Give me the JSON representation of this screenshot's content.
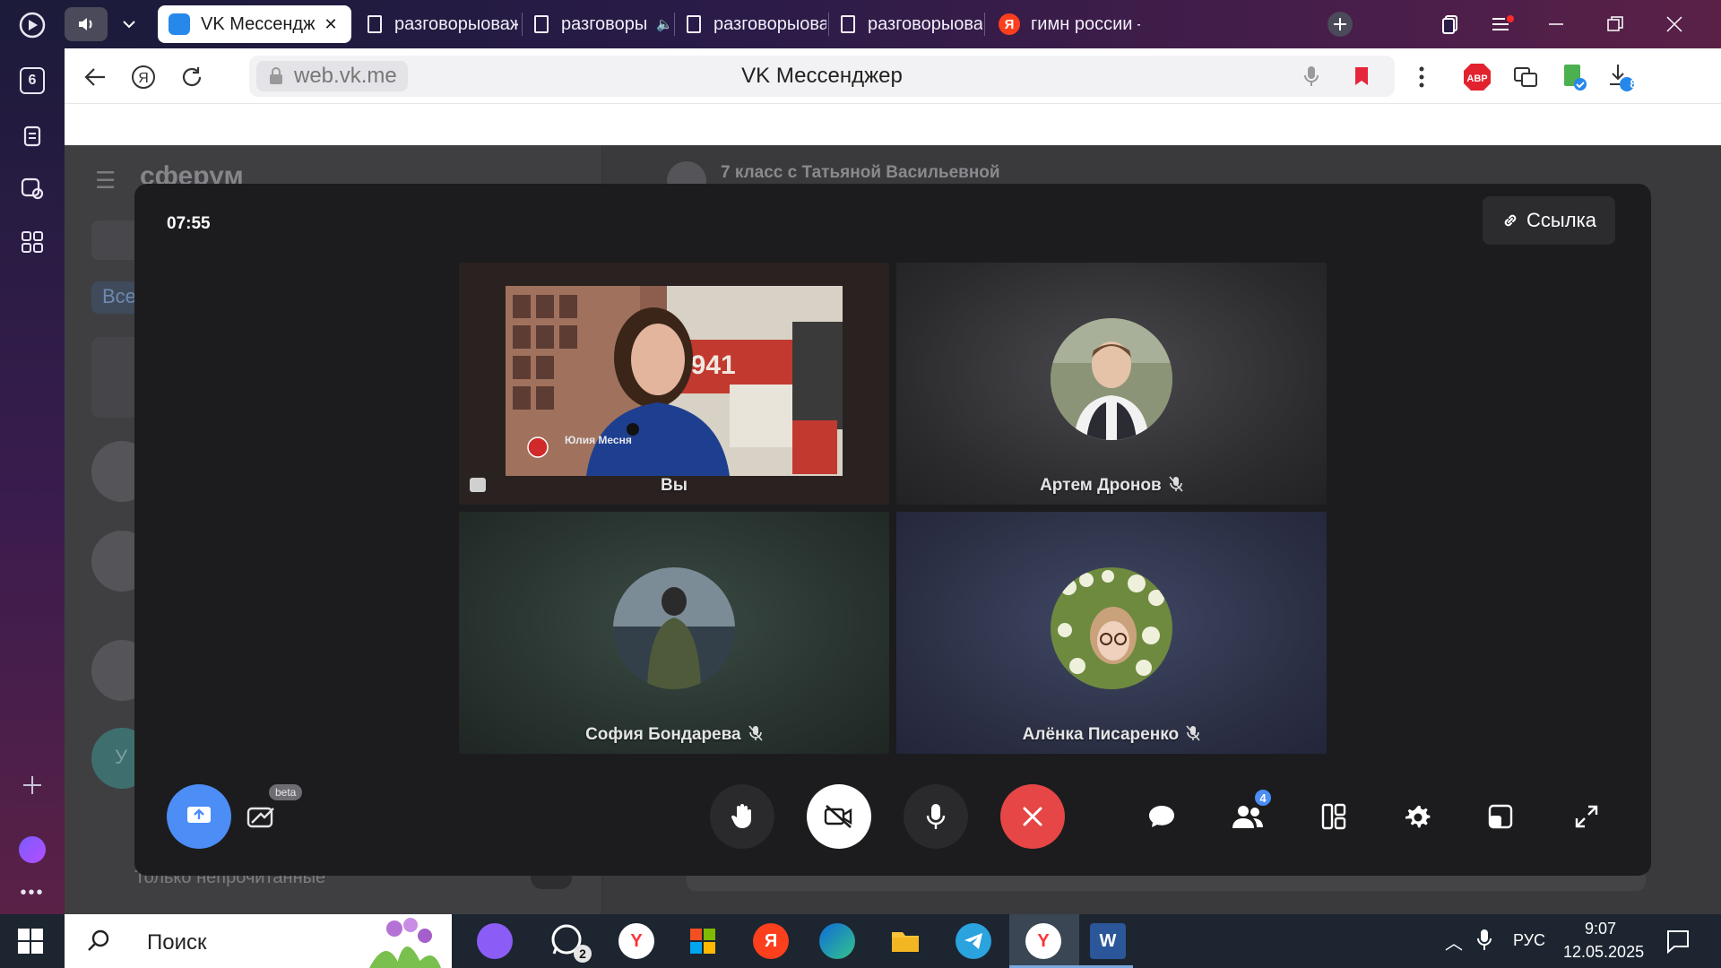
{
  "browser": {
    "tabs": [
      {
        "label": "VK Мессендж",
        "active": true
      },
      {
        "label": "разговорыоваж",
        "active": false
      },
      {
        "label": "разговоры",
        "active": false
      },
      {
        "label": "разговорыоваж",
        "active": false
      },
      {
        "label": "разговорыоваж",
        "active": false
      },
      {
        "label": "гимн россии — Я",
        "active": false
      }
    ],
    "rail_badge": "6",
    "url": "web.vk.me",
    "page_title": "VK Мессенджер",
    "download_count": "8",
    "abp_label": "ABP"
  },
  "messenger": {
    "brand": "сферум",
    "chat_title": "7 класс с Татьяной Васильевной",
    "filter_all": "Все",
    "unread_only": "Только непрочитанные",
    "avatar_letter": "У"
  },
  "call": {
    "timer": "07:55",
    "link_label": "Ссылка",
    "participants": [
      {
        "name": "Вы",
        "muted": false,
        "video": true
      },
      {
        "name": "Артем Дронов",
        "muted": true,
        "video": false
      },
      {
        "name": "София Бондарева",
        "muted": true,
        "video": false
      },
      {
        "name": "Алёнка Писаренко",
        "muted": true,
        "video": false
      }
    ],
    "video_overlay": {
      "year": "1941",
      "badge_name": "Юлия Месня"
    },
    "participants_count": "4",
    "beta_label": "beta",
    "icons": [
      "upload-icon",
      "effects-icon",
      "raise-hand-icon",
      "camera-off-icon",
      "microphone-icon",
      "hang-up-icon",
      "chat-icon",
      "participants-icon",
      "layout-icon",
      "settings-icon",
      "pip-icon",
      "fullscreen-icon"
    ]
  },
  "taskbar": {
    "search_label": "Поиск",
    "whatsapp_count": "2",
    "language": "РУС",
    "time": "9:07",
    "date": "12.05.2025"
  },
  "colors": {
    "call_bg": "#1c1c1e",
    "hangup_red": "#e64646",
    "accent_blue": "#4c8df6"
  }
}
